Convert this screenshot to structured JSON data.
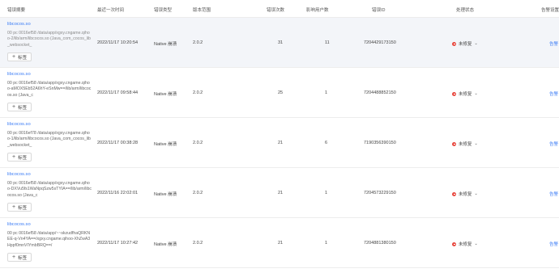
{
  "columns": {
    "summary": "错误摘要",
    "last_time": "最近一次时间",
    "type": "错误类型",
    "version": "版本范围",
    "count": "错误次数",
    "users": "影响用户数",
    "error_id": "错误ID",
    "status": "处理状态",
    "alert": "告警设置"
  },
  "tag_button_label": "标签",
  "rows": [
    {
      "lib": "libcocos.so",
      "stack": "00 pc 0016ef58 /data/app/xgxy.cngame.qihoo-2/lib/arm/libcocos.so (Java_com_cocos_lib_websocket_",
      "last_time": "2022/11/17 10:20:54",
      "type": "Native 崩溃",
      "version": "2.0.2",
      "count": "31",
      "users": "11",
      "error_id": "7204429173150",
      "status": "未修复",
      "alert": "告警"
    },
    {
      "lib": "libcocos.so",
      "stack": "00 pc 0016ef58 /data/app/xgxy.cngame.qihoo-aMOX5Eb52A6hY-eSnMw==/lib/arm/libcocos.so (Java_c",
      "last_time": "2022/11/17 09:58:44",
      "type": "Native 崩溃",
      "version": "2.0.2",
      "count": "25",
      "users": "1",
      "error_id": "7204488852150",
      "status": "未修复",
      "alert": "告警"
    },
    {
      "lib": "libcocos.so",
      "stack": "00 pc 0016ef78 /data/app/xgxy.cngame.qihoo-1/lib/arm/libcocos.so (Java_com_cocos_lib_websocket_",
      "last_time": "2022/11/17 00:38:28",
      "type": "Native 崩溃",
      "version": "2.0.2",
      "count": "21",
      "users": "6",
      "error_id": "7190356390150",
      "status": "未修复",
      "alert": "告警"
    },
    {
      "lib": "libcocos.so",
      "stack": "00 pc 0016ef58 /data/app/xgxy.cngame.qihoo-DXVu5fs1WaNpqSzw5sTYIA==/lib/arm/libcocos.so (Java_c",
      "last_time": "2022/11/16 22:02:01",
      "type": "Native 崩溃",
      "version": "2.0.2",
      "count": "21",
      "users": "1",
      "error_id": "7204573229150",
      "status": "未修复",
      "alert": "告警"
    },
    {
      "lib": "libcocos.so",
      "stack": "00 pc 0016ef58 /data/app/~~skzudfhaQRKNEE-q-Vn4YA==/xgxy.cngame.qihoo-XhZwA3Hppf0mnVIYmbBRQ==/",
      "last_time": "2022/11/17 10:27:42",
      "type": "Native 崩溃",
      "version": "2.0.2",
      "count": "21",
      "users": "1",
      "error_id": "7204881380150",
      "status": "未修复",
      "alert": "告警"
    }
  ]
}
